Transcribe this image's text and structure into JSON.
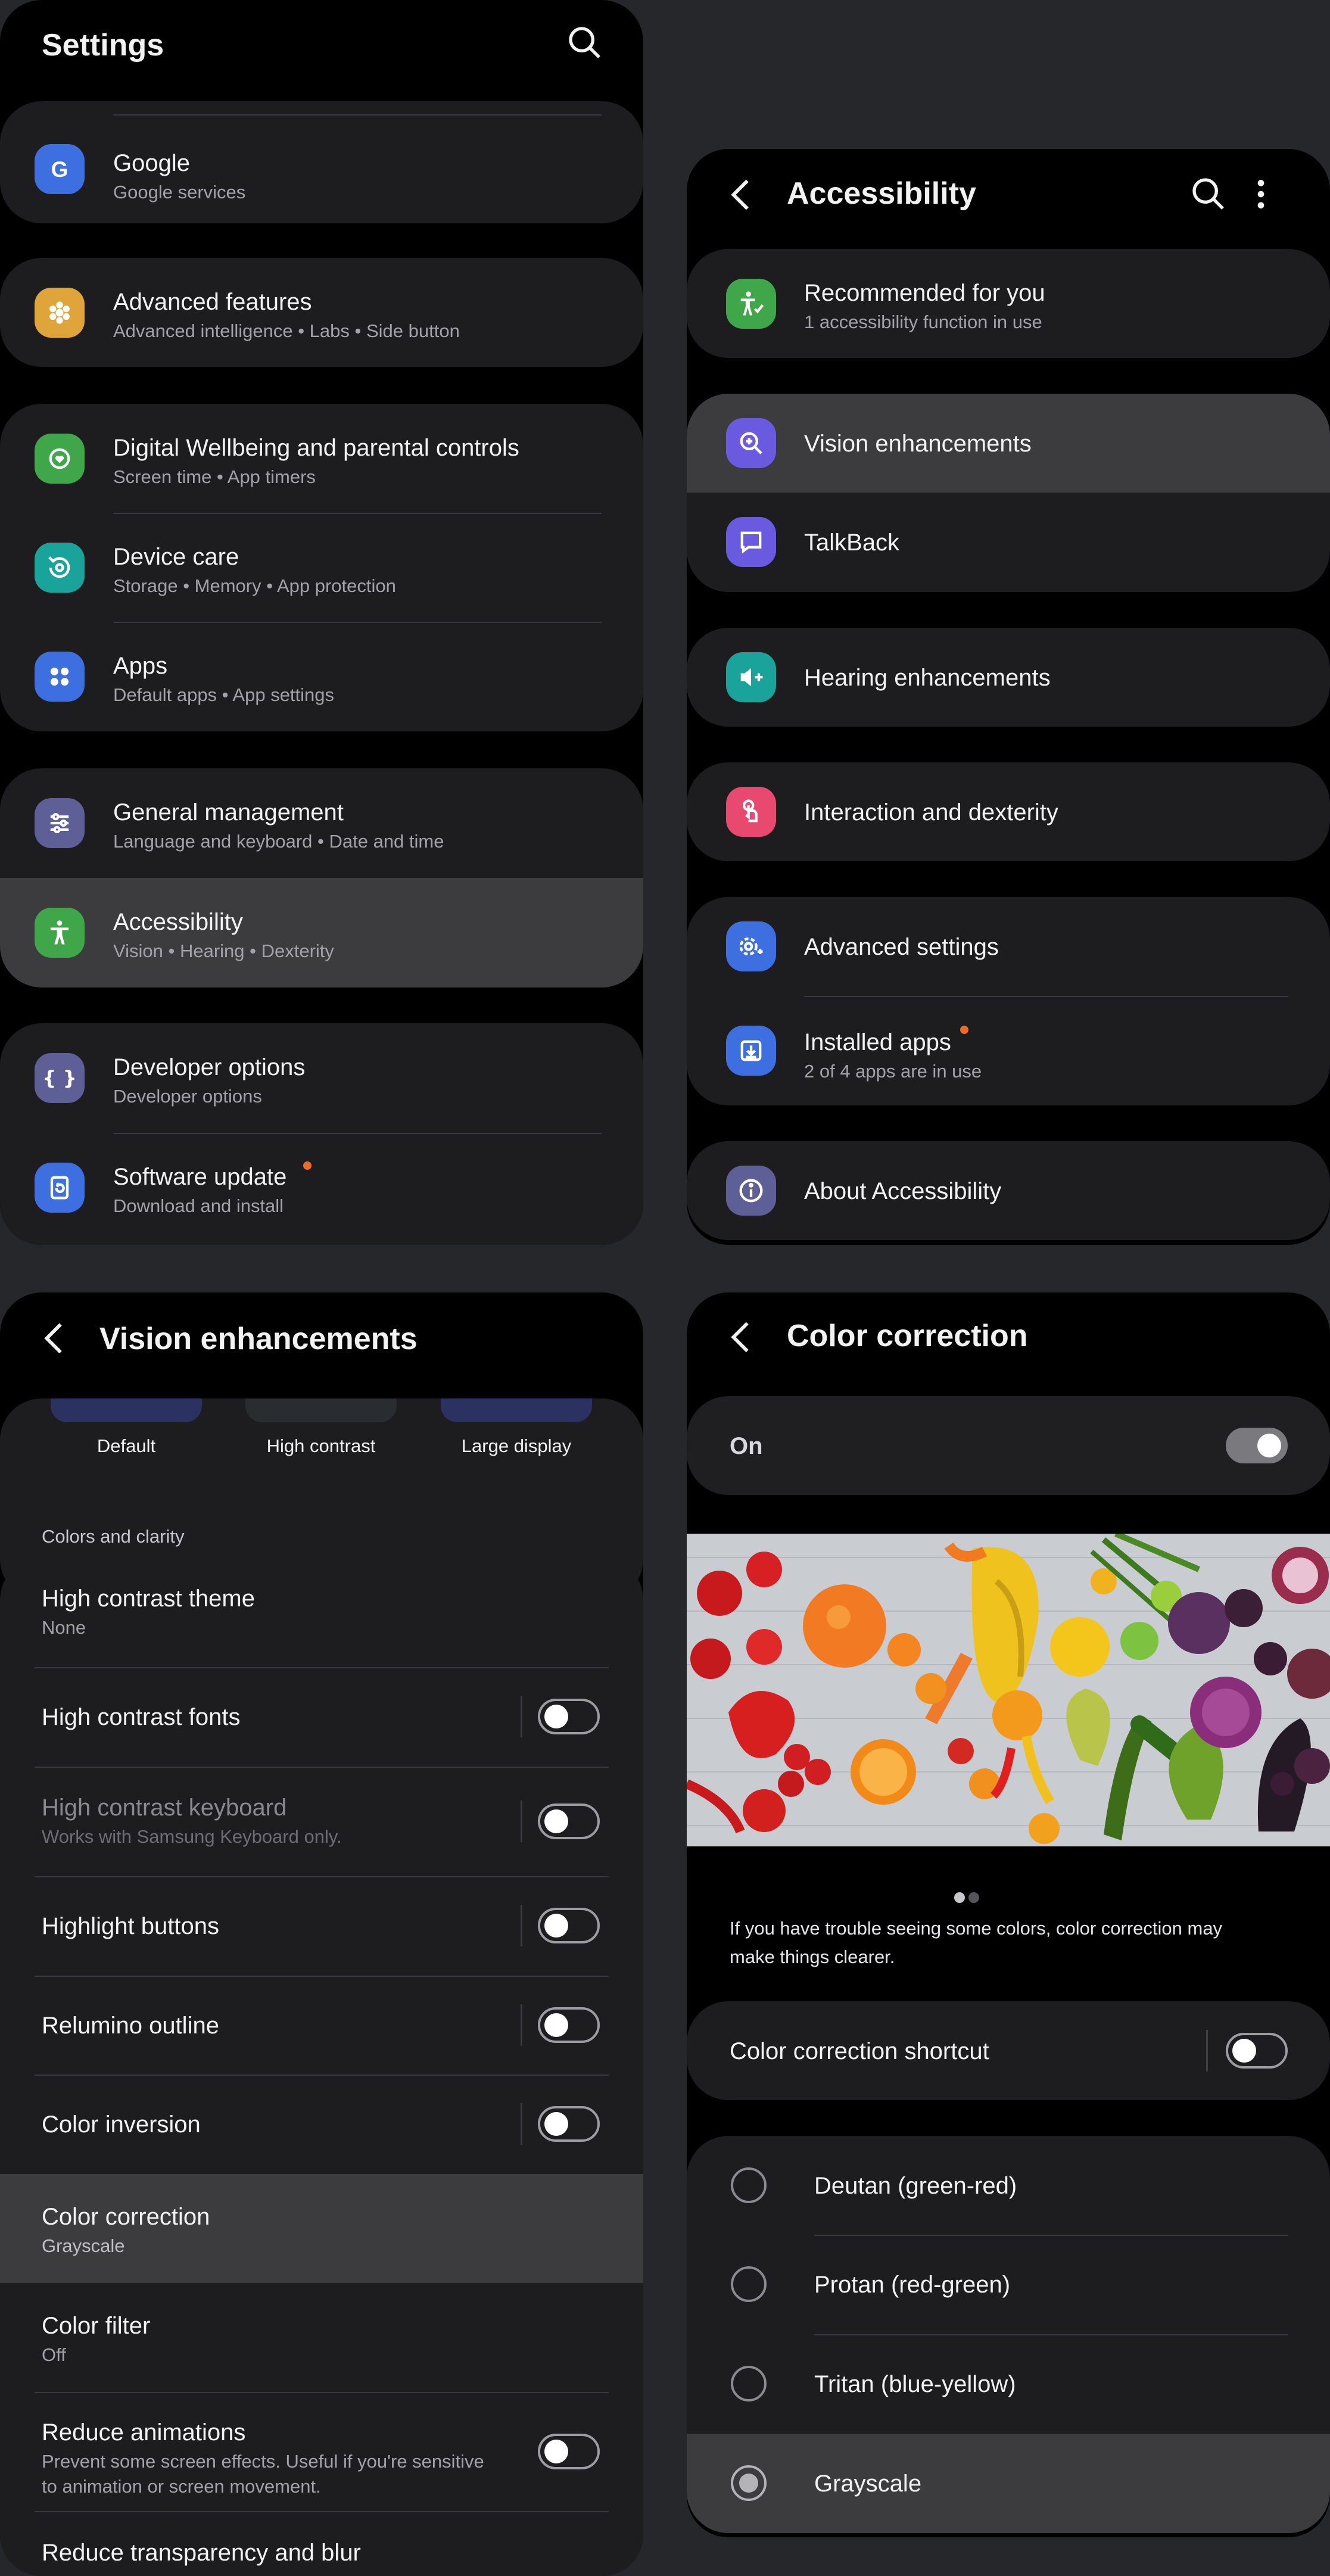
{
  "settings": {
    "title": "Settings",
    "google": {
      "title": "Google",
      "subtitle": "Google services"
    },
    "advanced_features": {
      "title": "Advanced features",
      "subtitle": "Advanced intelligence  •  Labs  •  Side button"
    },
    "digital_wellbeing": {
      "title": "Digital Wellbeing and parental controls",
      "subtitle": "Screen time  •  App timers"
    },
    "device_care": {
      "title": "Device care",
      "subtitle": "Storage  •  Memory  •  App protection"
    },
    "apps": {
      "title": "Apps",
      "subtitle": "Default apps  •  App settings"
    },
    "general_management": {
      "title": "General management",
      "subtitle": "Language and keyboard  •  Date and time"
    },
    "accessibility": {
      "title": "Accessibility",
      "subtitle": "Vision  •  Hearing  •  Dexterity"
    },
    "developer_options": {
      "title": "Developer options",
      "subtitle": "Developer options"
    },
    "software_update": {
      "title": "Software update",
      "subtitle": "Download and install"
    }
  },
  "accessibility_screen": {
    "title": "Accessibility",
    "recommended": {
      "title": "Recommended for you",
      "subtitle": "1 accessibility function in use"
    },
    "vision": "Vision enhancements",
    "talkback": "TalkBack",
    "hearing": "Hearing enhancements",
    "interaction": "Interaction and dexterity",
    "advanced_settings": "Advanced settings",
    "installed_apps": {
      "title": "Installed apps",
      "subtitle": "2 of 4 apps are in use"
    },
    "about": "About Accessibility"
  },
  "vision_screen": {
    "title": "Vision enhancements",
    "presets": [
      "Default",
      "High contrast",
      "Large display"
    ],
    "section_header": "Colors and clarity",
    "high_contrast_theme": {
      "title": "High contrast theme",
      "subtitle": "None"
    },
    "high_contrast_fonts": {
      "title": "High contrast fonts",
      "enabled": false
    },
    "high_contrast_keyboard": {
      "title": "High contrast keyboard",
      "subtitle": "Works with Samsung Keyboard only.",
      "enabled": false
    },
    "highlight_buttons": {
      "title": "Highlight buttons",
      "enabled": false
    },
    "relumino_outline": {
      "title": "Relumino outline",
      "enabled": false
    },
    "color_inversion": {
      "title": "Color inversion",
      "enabled": false
    },
    "color_correction": {
      "title": "Color correction",
      "subtitle": "Grayscale"
    },
    "color_filter": {
      "title": "Color filter",
      "subtitle": "Off"
    },
    "reduce_animations": {
      "title": "Reduce animations",
      "subtitle_line1": "Prevent some screen effects. Useful if you're sensitive",
      "subtitle_line2": "to animation or screen movement.",
      "enabled": false
    },
    "reduce_transparency": "Reduce transparency and blur"
  },
  "color_correction_screen": {
    "title": "Color correction",
    "master_toggle": {
      "label": "On",
      "enabled": true
    },
    "carousel": {
      "page": 1,
      "total": 2
    },
    "description_line1": "If you have trouble seeing some colors, color correction may",
    "description_line2": "make things clearer.",
    "shortcut": {
      "label": "Color correction shortcut",
      "enabled": false
    },
    "options": [
      "Deutan (green-red)",
      "Protan (red-green)",
      "Tritan (blue-yellow)",
      "Grayscale"
    ],
    "selected_option": "Grayscale"
  },
  "colors": {
    "background": "#26272b",
    "panel": "#000000",
    "card": "#1d1d20",
    "highlight": "#3c3c3f",
    "badge": "#f06a27"
  }
}
